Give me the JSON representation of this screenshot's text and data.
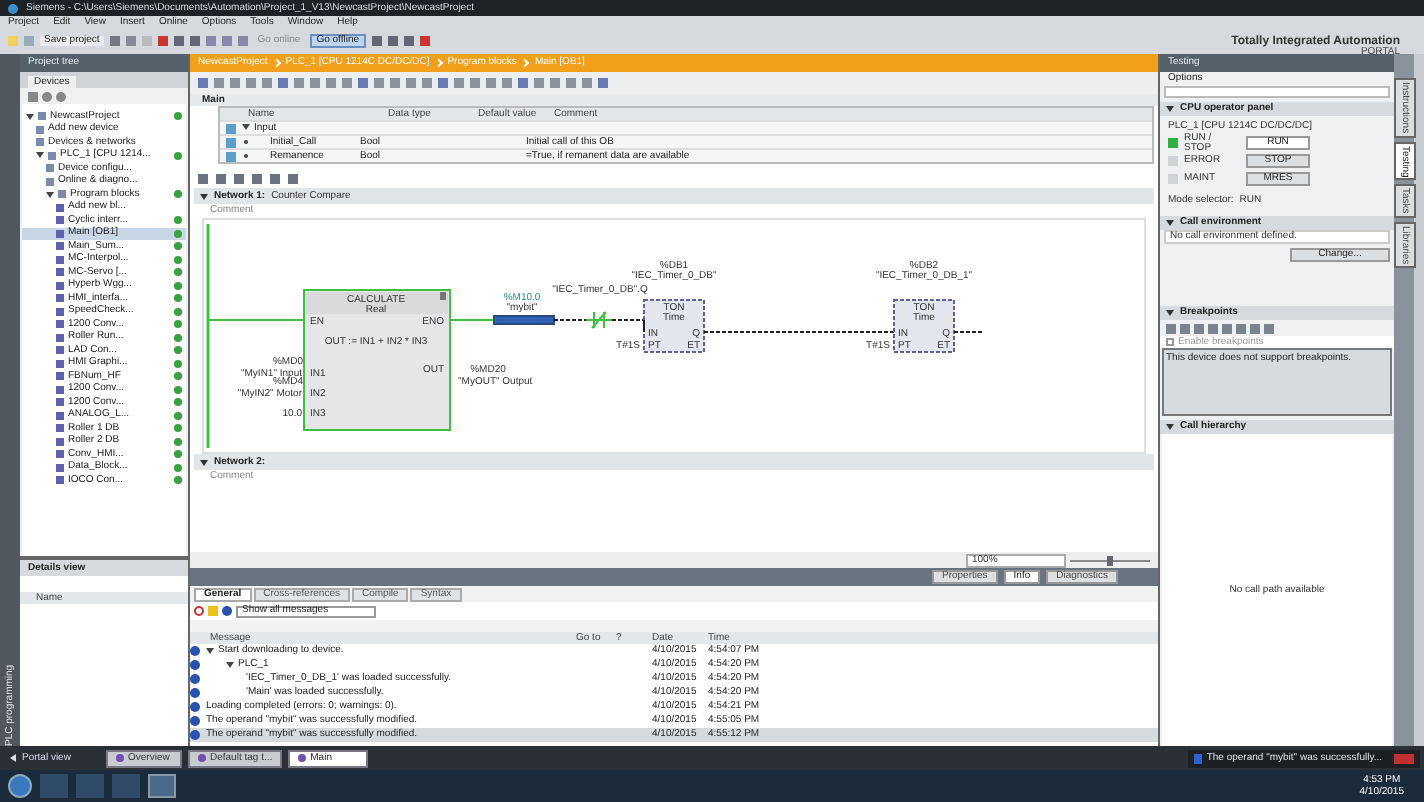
{
  "window": {
    "title": "Siemens  -  C:\\Users\\Siemens\\Documents\\Automation\\Project_1_V13\\NewcastProject\\NewcastProject"
  },
  "menu": [
    "Project",
    "Edit",
    "View",
    "Insert",
    "Online",
    "Options",
    "Tools",
    "Window",
    "Help"
  ],
  "toolbar": {
    "save": "Save project",
    "go_online": "Go online",
    "go_offline": "Go offline"
  },
  "brand": {
    "line_1": "Totally Integrated Automation",
    "line_2": "PORTAL"
  },
  "project_tree": {
    "title": "Project tree",
    "side_tab": "PLC programming",
    "tab": "Devices",
    "tree": [
      {
        "label": "NewcastProject",
        "selected": false,
        "consistent": true,
        "children": [
          {
            "label": "Add new device",
            "selected": false,
            "consistent": false
          },
          {
            "label": "Devices & networks",
            "selected": false,
            "consistent": false
          },
          {
            "label": "PLC_1 [CPU 1214...",
            "selected": false,
            "consistent": true,
            "children": [
              {
                "label": "Device configu...",
                "selected": false,
                "consistent": false
              },
              {
                "label": "Online & diagno...",
                "selected": false,
                "consistent": false
              },
              {
                "label": "Program blocks",
                "selected": false,
                "consistent": true,
                "children": [
                  {
                    "label": "Add new bl...",
                    "selected": false,
                    "consistent": false
                  },
                  {
                    "label": "Cyclic interr...",
                    "selected": false,
                    "consistent": true
                  },
                  {
                    "label": "Main [OB1]",
                    "selected": true,
                    "consistent": true
                  },
                  {
                    "label": "Main_Sum...",
                    "selected": false,
                    "consistent": true
                  },
                  {
                    "label": "MC-Interpol...",
                    "selected": false,
                    "consistent": true
                  },
                  {
                    "label": "MC-Servo [...",
                    "selected": false,
                    "consistent": true
                  },
                  {
                    "label": "Hyperb Wgg...",
                    "selected": false,
                    "consistent": true
                  },
                  {
                    "label": "HMI_interfa...",
                    "selected": false,
                    "consistent": true
                  },
                  {
                    "label": "SpeedCheck...",
                    "selected": false,
                    "consistent": true
                  },
                  {
                    "label": "1200 Conv...",
                    "selected": false,
                    "consistent": true
                  },
                  {
                    "label": "Roller Run...",
                    "selected": false,
                    "consistent": true
                  },
                  {
                    "label": "LAD Con...",
                    "selected": false,
                    "consistent": true
                  },
                  {
                    "label": "HMI Graphi...",
                    "selected": false,
                    "consistent": true
                  },
                  {
                    "label": "FBNum_HF",
                    "selected": false,
                    "consistent": true
                  },
                  {
                    "label": "1200 Conv...",
                    "selected": false,
                    "consistent": true
                  },
                  {
                    "label": "1200 Conv...",
                    "selected": false,
                    "consistent": true
                  },
                  {
                    "label": "ANALOG_L...",
                    "selected": false,
                    "consistent": true
                  },
                  {
                    "label": "Roller 1 DB",
                    "selected": false,
                    "consistent": true
                  },
                  {
                    "label": "Roller 2 DB",
                    "selected": false,
                    "consistent": true
                  },
                  {
                    "label": "Conv_HMI...",
                    "selected": false,
                    "consistent": true
                  },
                  {
                    "label": "Data_Block...",
                    "selected": false,
                    "consistent": true
                  },
                  {
                    "label": "IOCO Con...",
                    "selected": false,
                    "consistent": true
                  }
                ]
              }
            ]
          }
        ]
      }
    ],
    "details": {
      "title": "Details view",
      "column": "Name"
    }
  },
  "editor": {
    "breadcrumb": [
      "NewcastProject",
      "PLC_1 [CPU 1214C DC/DC/DC]",
      "Program blocks",
      "Main [OB1]"
    ],
    "block_name": "Main",
    "interface": {
      "columns": [
        "Name",
        "Data type",
        "Default value",
        "Comment"
      ],
      "rows": [
        {
          "name": "Input",
          "data_type": "",
          "comment": "",
          "expanded": true
        },
        {
          "name": "Initial_Call",
          "data_type": "Bool",
          "comment": "Initial call of this OB",
          "expanded": false
        },
        {
          "name": "Remanence",
          "data_type": "Bool",
          "comment": "=True, if remanent data are available",
          "expanded": false
        }
      ]
    },
    "networks": [
      {
        "title": "Network 1:",
        "subtitle": "Counter Compare",
        "comment": "Comment",
        "expanded": true,
        "diagram": {
          "calc": {
            "title": "CALCULATE",
            "type": "Real",
            "en": "EN",
            "eno": "ENO",
            "expression": "OUT := IN1 + IN2 * IN3",
            "out_pin": "OUT",
            "out_address": "%MD20",
            "out_tag": "\"MyOUT\" Output",
            "inputs": [
              {
                "pin": "IN1",
                "address": "%MD0",
                "tag": "\"MyIN1\" Input"
              },
              {
                "pin": "IN2",
                "address": "%MD4",
                "tag": "\"MyIN2\" Motor"
              },
              {
                "pin": "IN3",
                "tag": "10.0"
              }
            ]
          },
          "coil": {
            "address": "%M10.0",
            "tag": "\"mybit\"",
            "selected": true
          },
          "contact": {
            "tag": "\"IEC_Timer_0_DB\".Q",
            "negated": true
          },
          "timers": [
            {
              "address": "%DB1",
              "tag": "\"IEC_Timer_0_DB\"",
              "type": "TON",
              "time": "Time",
              "pin_in": "IN",
              "pin_q": "Q",
              "pin_pt": "PT",
              "pin_et": "ET",
              "pt": "T#1S"
            },
            {
              "address": "%DB2",
              "tag": "\"IEC_Timer_0_DB_1\"",
              "type": "TON",
              "time": "Time",
              "pin_in": "IN",
              "pin_q": "Q",
              "pin_pt": "PT",
              "pin_et": "ET",
              "pt": "T#1S"
            }
          ]
        }
      },
      {
        "title": "Network 2:",
        "comment": "Comment",
        "expanded": true
      }
    ],
    "zoom": "100%",
    "zoom_slider": {
      "level": 0.5
    }
  },
  "inspector_tabs": [
    {
      "label": "Properties",
      "selected": false
    },
    {
      "label": "Info",
      "selected": true
    },
    {
      "label": "Diagnostics",
      "selected": false
    }
  ],
  "info": {
    "tabs": [
      {
        "label": "General",
        "selected": true
      },
      {
        "label": "Cross-references",
        "selected": false
      },
      {
        "label": "Compile",
        "selected": false
      },
      {
        "label": "Syntax",
        "selected": false
      }
    ],
    "filter": "Show all messages",
    "columns": [
      "Message",
      "Go to",
      "?",
      "Date",
      "Time"
    ],
    "messages": [
      {
        "text": "Start downloading to device.",
        "date": "4/10/2015",
        "time": "4:54:07 PM",
        "selected": false,
        "children": [
          {
            "text": "PLC_1",
            "date": "4/10/2015",
            "time": "4:54:20 PM",
            "selected": false,
            "children": [
              {
                "text": "'IEC_Timer_0_DB_1' was loaded successfully.",
                "date": "4/10/2015",
                "time": "4:54:20 PM",
                "selected": false
              },
              {
                "text": "'Main' was loaded successfully.",
                "date": "4/10/2015",
                "time": "4:54:20 PM",
                "selected": false
              }
            ]
          }
        ]
      },
      {
        "text": "Loading completed (errors: 0; warnings: 0).",
        "date": "4/10/2015",
        "time": "4:54:21 PM",
        "selected": false
      },
      {
        "text": "The operand \"mybit\" was successfully modified.",
        "date": "4/10/2015",
        "time": "4:55:05 PM",
        "selected": false
      },
      {
        "text": "The operand \"mybit\" was successfully modified.",
        "date": "4/10/2015",
        "time": "4:55:12 PM",
        "selected": true
      }
    ]
  },
  "testing": {
    "title": "Testing",
    "options": "Options",
    "cpu_panel": {
      "title": "CPU operator panel",
      "device": "PLC_1 [CPU 1214C DC/DC/DC]",
      "leds": [
        {
          "label": "RUN / STOP",
          "on": true,
          "button": "RUN"
        },
        {
          "label": "ERROR",
          "on": false,
          "button": "STOP"
        },
        {
          "label": "MAINT",
          "on": false,
          "button": "MRES"
        }
      ],
      "mode_label": "Mode selector:",
      "mode": "RUN"
    },
    "call_env": {
      "title": "Call environment",
      "text": "No call environment defined.",
      "button": "Change..."
    },
    "breakpoints": {
      "title": "Breakpoints",
      "checkbox": "Enable breakpoints",
      "checked": false,
      "text": "This device does not support breakpoints."
    },
    "call_hierarchy": {
      "title": "Call hierarchy",
      "text": "No call path available"
    }
  },
  "side_tabs": [
    {
      "label": "Instructions",
      "selected": false
    },
    {
      "label": "Testing",
      "selected": true
    },
    {
      "label": "Tasks",
      "selected": false
    },
    {
      "label": "Libraries",
      "selected": false
    }
  ],
  "portal_bar": {
    "portal_view": "Portal view",
    "tabs": [
      {
        "label": "Overview",
        "selected": false
      },
      {
        "label": "Default tag t...",
        "selected": false
      },
      {
        "label": "Main",
        "selected": true
      }
    ],
    "status": "The operand \"mybit\" was successfully..."
  },
  "taskbar": {
    "time": "4:53 PM",
    "date": "4/10/2015"
  }
}
